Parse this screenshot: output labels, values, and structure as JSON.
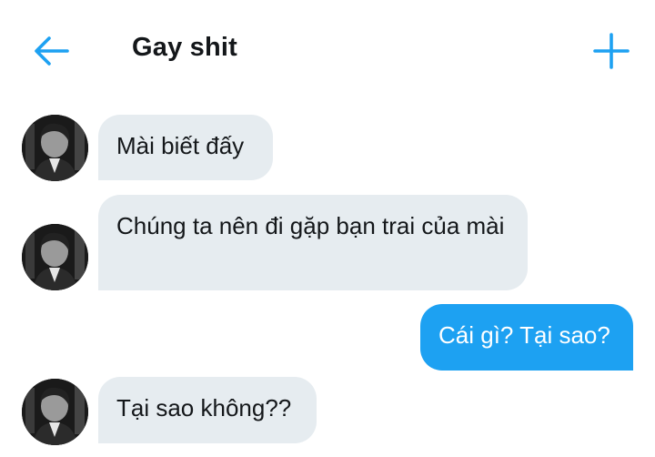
{
  "header": {
    "back_icon": "arrow-left-icon",
    "title": "Gay shit",
    "add_icon": "plus-icon",
    "accent_color": "#1da1f2"
  },
  "messages": [
    {
      "direction": "incoming",
      "text": "Mài biết đấy"
    },
    {
      "direction": "incoming",
      "text": "Chúng ta nên đi gặp bạn trai của mài"
    },
    {
      "direction": "outgoing",
      "text": "Cái gì? Tại sao?"
    },
    {
      "direction": "incoming",
      "text": "Tại sao không??"
    }
  ],
  "colors": {
    "incoming_bubble": "#e6ecf0",
    "outgoing_bubble": "#1da1f2",
    "text": "#14171a"
  }
}
